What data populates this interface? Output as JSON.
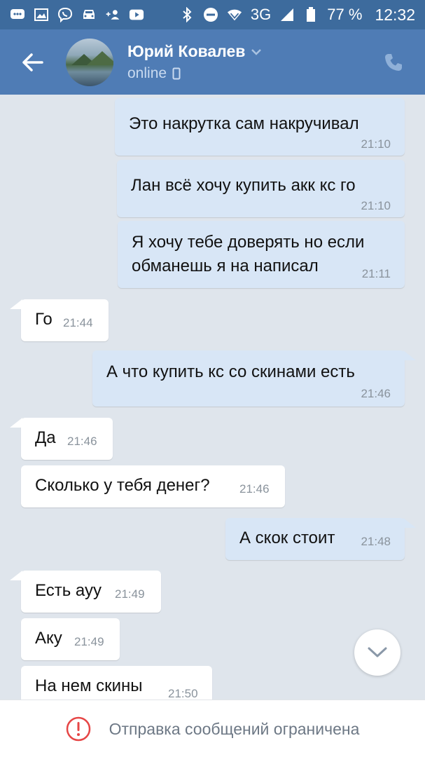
{
  "status_bar": {
    "network": "3G",
    "battery": "77 %",
    "time": "12:32"
  },
  "header": {
    "name": "Юрий Ковалев",
    "status": "online"
  },
  "messages": [
    {
      "dir": "out",
      "text": "Это накрутка сам накручивал",
      "time": "21:10"
    },
    {
      "dir": "out",
      "text": "Лан всё хочу купить акк кс го",
      "time": "21:10"
    },
    {
      "dir": "out",
      "text": "Я хочу тебе доверять но если\nобманешь я на написал",
      "time": "21:11"
    },
    {
      "dir": "in",
      "text": "Го",
      "time": "21:44"
    },
    {
      "dir": "out",
      "text": "А что купить кс со скинами есть",
      "time": "21:46"
    },
    {
      "dir": "in",
      "text": "Да",
      "time": "21:46"
    },
    {
      "dir": "in",
      "text": "Сколько у тебя денег?",
      "time": "21:46"
    },
    {
      "dir": "out",
      "text": "А скок стоит",
      "time": "21:48"
    },
    {
      "dir": "in",
      "text": "Есть ауу",
      "time": "21:49"
    },
    {
      "dir": "in",
      "text": "Аку",
      "time": "21:49"
    },
    {
      "dir": "in",
      "text": "На нем скины",
      "time": "21:50"
    }
  ],
  "bottom": {
    "restriction_text": "Отправка сообщений ограничена"
  },
  "colors": {
    "status_bar": "#3d6b9d",
    "header": "#4f7cb5",
    "chat_bg": "#dfe5ec",
    "outgoing_bubble": "#d8e6f6",
    "incoming_bubble": "#ffffff",
    "alert": "#e64646"
  }
}
